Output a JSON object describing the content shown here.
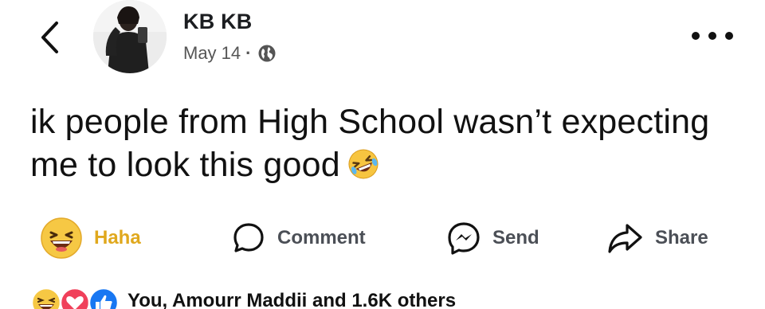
{
  "header": {
    "back_icon": "chevron-left-icon",
    "author_name": "KB KB",
    "date": "May 14",
    "separator": "·",
    "privacy_icon": "globe-icon",
    "more_icon": "more-horizontal-icon"
  },
  "post": {
    "text": "ik people from High School wasn’t expecting me to look this good",
    "trailing_emoji": "rolling-on-floor-laughing-icon"
  },
  "actions": [
    {
      "label": "Haha",
      "icon": "haha-emoji-icon"
    },
    {
      "label": "Comment",
      "icon": "comment-icon"
    },
    {
      "label": "Send",
      "icon": "messenger-icon"
    },
    {
      "label": "Share",
      "icon": "share-icon"
    }
  ],
  "reactions": {
    "icons": [
      "haha-reaction-icon",
      "love-reaction-icon",
      "like-reaction-icon"
    ],
    "summary": "You, Amourr Maddii and 1.6K others"
  },
  "colors": {
    "haha_yellow": "#f5c33b",
    "haha_label": "#e0a81d",
    "love_red": "#f0405a",
    "like_blue": "#1877f2",
    "text_dark": "#111111",
    "text_muted": "#4b4f56"
  }
}
